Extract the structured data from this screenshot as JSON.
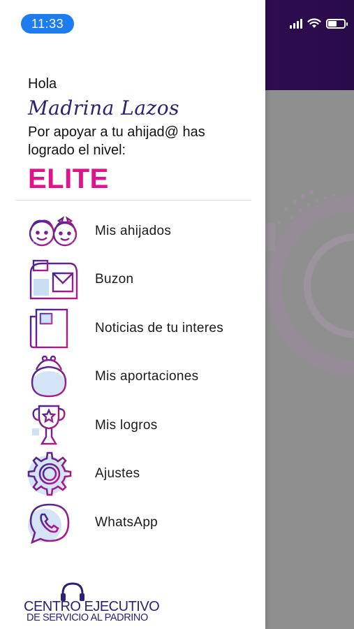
{
  "status_bar": {
    "time": "11:33",
    "icons": [
      "signal-icon",
      "wifi-icon",
      "battery-icon"
    ]
  },
  "greeting": {
    "hello": "Hola",
    "name": "Madrina Lazos",
    "message": "Por apoyar a tu ahijad@ has logrado el nivel:",
    "level": "ELITE"
  },
  "menu": {
    "items": [
      {
        "label": "Mis ahijados",
        "icon": "children-faces-icon"
      },
      {
        "label": "Buzon",
        "icon": "mailbox-icon"
      },
      {
        "label": "Noticias de tu interes",
        "icon": "newspaper-icon"
      },
      {
        "label": "Mis aportaciones",
        "icon": "coin-purse-icon"
      },
      {
        "label": "Mis logros",
        "icon": "trophy-icon"
      },
      {
        "label": "Ajustes",
        "icon": "gear-icon"
      },
      {
        "label": "WhatsApp",
        "icon": "whatsapp-icon"
      }
    ]
  },
  "footer": {
    "logo_line1": "CENTRO EJECUTIVO",
    "logo_line2": "DE SERVICIO AL PADRINO"
  },
  "colors": {
    "brand_purple": "#2b2274",
    "level_pink": "#e0148a",
    "header_bg": "#3a0f5c",
    "time_pill": "#1c7cf0",
    "overlay_gray": "#8f8f8f"
  }
}
